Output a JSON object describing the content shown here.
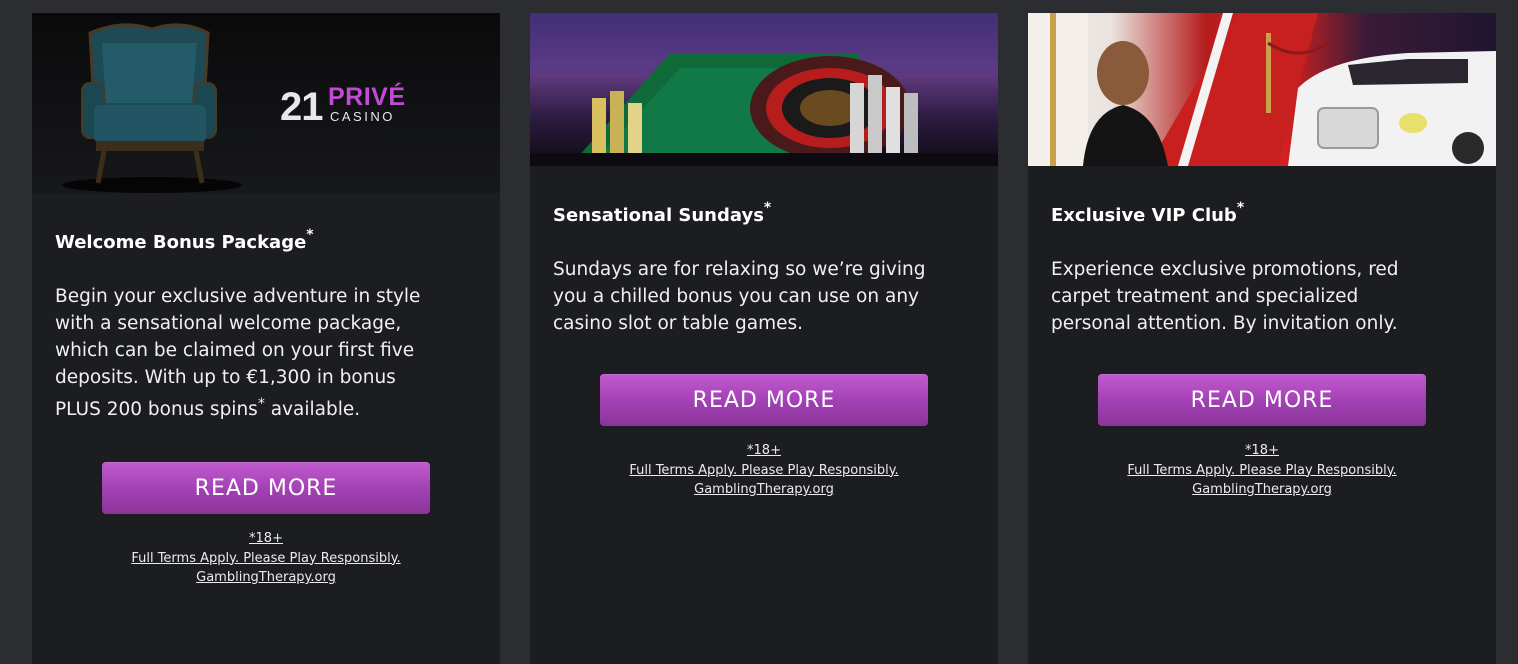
{
  "cards": [
    {
      "banner": {
        "logo_number": "21",
        "logo_word": "PRIVÉ",
        "logo_sub": "CASINO"
      },
      "title": "Welcome Bonus Package",
      "title_mark": "*",
      "description_lines": [
        "Begin your exclusive adventure in style",
        "with a sensational welcome package,",
        "which can be claimed on your first five",
        "deposits. With up to €1,300 in bonus"
      ],
      "description_last_pre": "PLUS 200 bonus spins",
      "description_last_mark": "*",
      "description_last_post": " available.",
      "button_label": "READ MORE",
      "terms": {
        "age": "*18+",
        "conditions": "Full Terms Apply. Please Play Responsibly.",
        "link": "GamblingTherapy.org"
      }
    },
    {
      "title": "Sensational Sundays",
      "title_mark": "*",
      "description_lines": [
        "Sundays are for relaxing so we’re giving",
        "you a chilled bonus you can use on any",
        "casino slot or table games."
      ],
      "button_label": "READ MORE",
      "terms": {
        "age": "*18+",
        "conditions": "Full Terms Apply. Please Play Responsibly.",
        "link": "GamblingTherapy.org"
      }
    },
    {
      "title": "Exclusive VIP Club",
      "title_mark": "*",
      "description_lines": [
        "Experience exclusive promotions, red",
        "carpet treatment and specialized",
        "personal attention. By invitation only."
      ],
      "button_label": "READ MORE",
      "terms": {
        "age": "*18+",
        "conditions": "Full Terms Apply. Please Play Responsibly.",
        "link": "GamblingTherapy.org"
      }
    }
  ],
  "colors": {
    "page_background": "#2b2d31",
    "card_background": "#1c1d20",
    "button_gradient_top": "#c35ad0",
    "button_gradient_bottom": "#8c3599",
    "logo_accent": "#c24bd6"
  }
}
